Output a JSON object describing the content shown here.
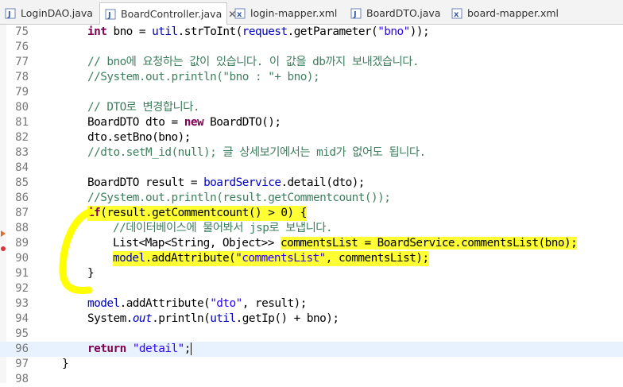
{
  "tabs": [
    {
      "label": "LoginDAO.java",
      "icon": "java-file-icon",
      "active": false
    },
    {
      "label": "BoardController.java",
      "icon": "java-file-icon",
      "active": true
    },
    {
      "label": "login-mapper.xml",
      "icon": "xml-file-icon",
      "active": false
    },
    {
      "label": "BoardDTO.java",
      "icon": "java-file-icon",
      "active": false
    },
    {
      "label": "board-mapper.xml",
      "icon": "xml-file-icon",
      "active": false
    }
  ],
  "editor": {
    "lines": [
      {
        "num": "75",
        "parts": [
          "int",
          " bno = ",
          "util",
          ".strToInt(",
          "request",
          ".getParameter(",
          "\"bno\"",
          "));"
        ]
      },
      {
        "num": "76",
        "parts": []
      },
      {
        "num": "77",
        "parts": [
          "// bno에 요청하는 값이 있습니다. 이 값을 db까지 보내겠습니다."
        ]
      },
      {
        "num": "78",
        "parts": [
          "//System.out.println(\"bno : \"+ bno);"
        ]
      },
      {
        "num": "79",
        "parts": []
      },
      {
        "num": "80",
        "parts": [
          "// DTO로 변경합니다."
        ]
      },
      {
        "num": "81",
        "parts": [
          "BoardDTO dto = ",
          "new",
          " BoardDTO();"
        ]
      },
      {
        "num": "82",
        "parts": [
          "dto.setBno(bno);"
        ]
      },
      {
        "num": "83",
        "parts": [
          "//dto.setM_id(null); 글 상세보기에서는 mid가 없어도 됩니다."
        ]
      },
      {
        "num": "84",
        "parts": []
      },
      {
        "num": "85",
        "parts": [
          "BoardDTO result = ",
          "boardService",
          ".detail(dto);"
        ]
      },
      {
        "num": "86",
        "parts": [
          "//System.out.println(result.getCommentcount());"
        ]
      },
      {
        "num": "87",
        "parts": [
          "if",
          "(result.getCommentcount() > 0) {"
        ]
      },
      {
        "num": "88",
        "parts": [
          "//데이터베이스에 물어봐서 jsp로 보냅니다."
        ]
      },
      {
        "num": "89",
        "parts": [
          "List<Map<String, Object>> ",
          "commentsList = BoardService.commentsList(bno);"
        ]
      },
      {
        "num": "90",
        "parts": [
          "model",
          ".addAttribute(",
          "\"commentsList\"",
          ", commentsList);"
        ]
      },
      {
        "num": "91",
        "parts": [
          "}"
        ]
      },
      {
        "num": "92",
        "parts": []
      },
      {
        "num": "93",
        "parts": [
          "model",
          ".addAttribute(",
          "\"dto\"",
          ", result);"
        ]
      },
      {
        "num": "94",
        "parts": [
          "System.",
          "out",
          ".println(",
          "util",
          ".getIp() + bno);"
        ]
      },
      {
        "num": "95",
        "parts": []
      },
      {
        "num": "96",
        "parts": [
          "return",
          " ",
          "\"detail\"",
          ";"
        ]
      },
      {
        "num": "97",
        "parts": [
          "}"
        ]
      },
      {
        "num": "98",
        "parts": []
      }
    ]
  },
  "colors": {
    "keyword": "#7f0055",
    "string": "#2a00ff",
    "comment": "#3f7f5f",
    "field": "#0000c0",
    "highlight": "#ffff33",
    "current_line": "#e8f2fe"
  }
}
